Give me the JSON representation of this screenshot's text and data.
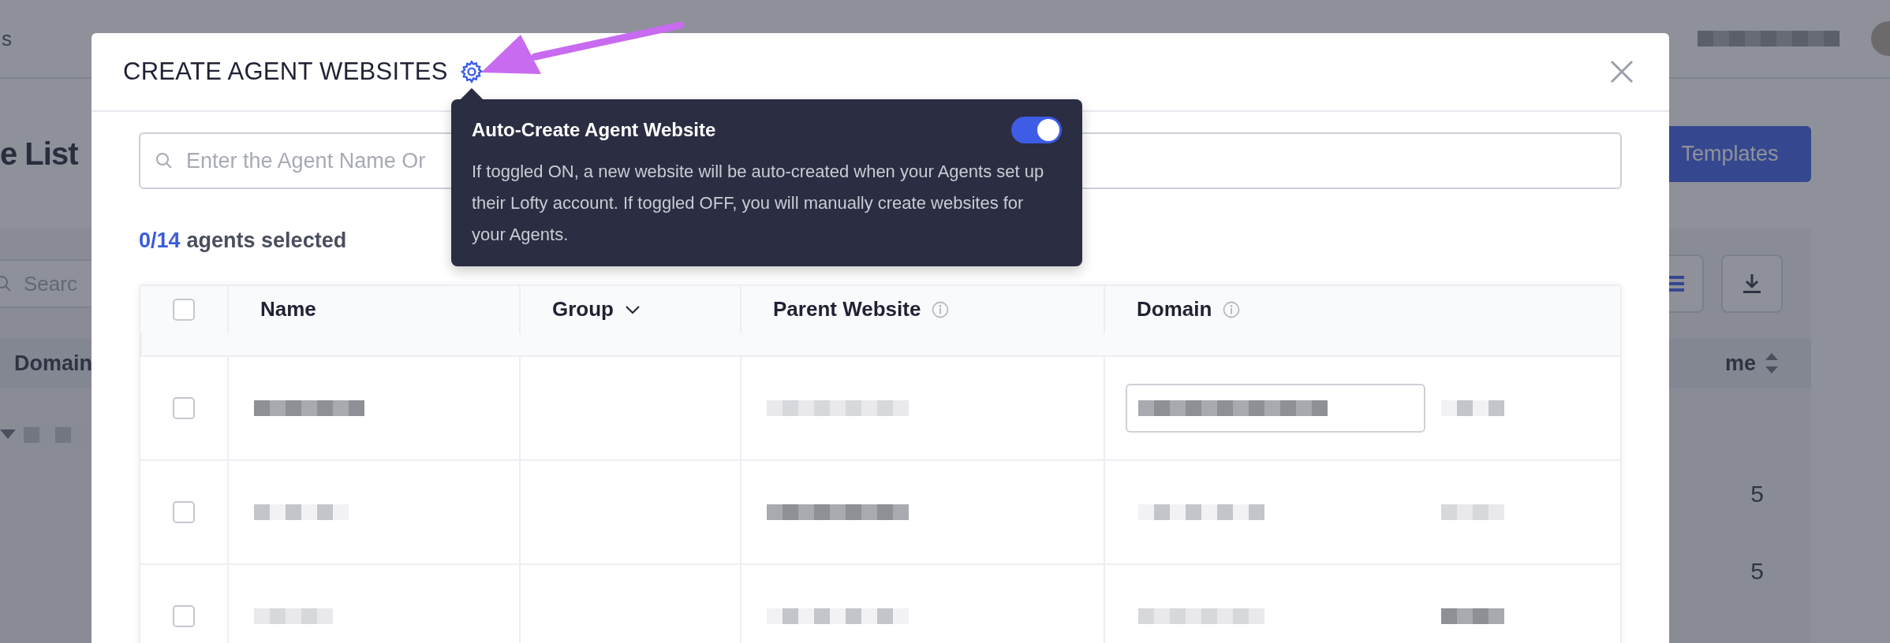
{
  "background": {
    "nav_text": "s",
    "heading": "e List",
    "templates_button": "Templates",
    "search_placeholder": "Searc",
    "columns": [
      "Domain",
      "me"
    ],
    "values": [
      "5",
      "5"
    ]
  },
  "modal": {
    "title": "CREATE AGENT WEBSITES",
    "tooltip": {
      "title": "Auto-Create Agent Website",
      "toggle_on": true,
      "text": "If toggled ON, a new website will be auto-created when your Agents set up their Lofty account. If toggled OFF, you will manually create websites for your Agents."
    },
    "search": {
      "placeholder": "Enter the Agent Name Or"
    },
    "selection": {
      "count": "0/14",
      "label": "agents selected"
    },
    "table": {
      "select_all_checked": false,
      "columns": [
        {
          "label": "Name",
          "kind": "plain"
        },
        {
          "label": "Group",
          "kind": "sort"
        },
        {
          "label": "Parent Website",
          "kind": "info"
        },
        {
          "label": "Domain",
          "kind": "info"
        }
      ],
      "rows": [
        {
          "checked": false,
          "editing": true
        },
        {
          "checked": false,
          "editing": false
        },
        {
          "checked": false,
          "editing": false
        }
      ]
    }
  }
}
